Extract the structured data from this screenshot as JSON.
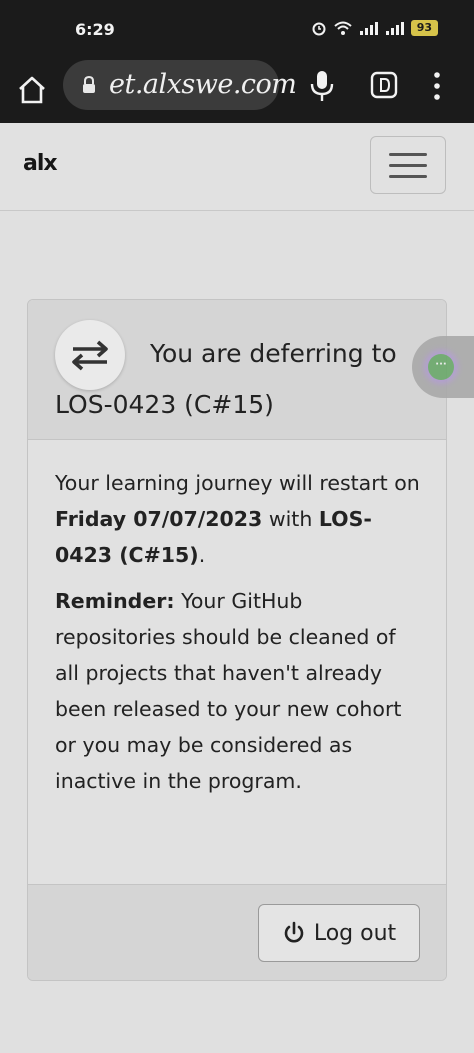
{
  "status_bar": {
    "time": "6:29",
    "battery": "93"
  },
  "browser": {
    "url": "et.alxswe.com"
  },
  "navbar": {
    "logo": "alx"
  },
  "card": {
    "header_line1": "You are deferring to",
    "header_line2": "LOS-0423 (C#15)",
    "body": {
      "p1_part1": "Your learning journey will restart on ",
      "p1_bold_date": "Friday 07/07/2023",
      "p1_part2": " with ",
      "p1_bold_cohort": "LOS-0423 (C#15)",
      "p1_end": ".",
      "p2_bold": "Reminder:",
      "p2_text": " Your GitHub repositories should be cleaned of all projects that haven't already been released to your new cohort or you may be considered as inactive in the program."
    },
    "logout_label": "Log out"
  },
  "colors": {
    "status_bg": "#1b1b1b",
    "page_bg": "#e0e0e0",
    "card_header_bg": "#d5d5d5",
    "battery": "#d6c34a"
  },
  "icons": {
    "home": "home-icon",
    "lock": "lock-icon",
    "mic": "mic-icon",
    "extension": "extension-icon",
    "menu": "more-vertical-icon",
    "hamburger": "hamburger-icon",
    "swap": "swap-arrows-icon",
    "power": "power-icon",
    "float": "floating-bubble-icon"
  }
}
